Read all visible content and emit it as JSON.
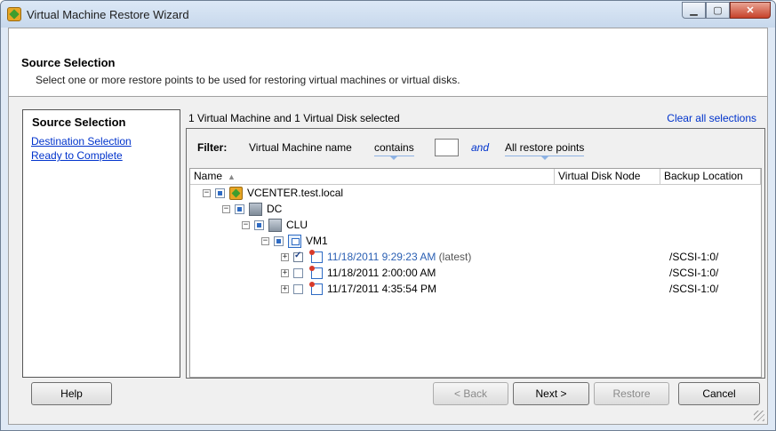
{
  "window": {
    "title": "Virtual Machine Restore Wizard"
  },
  "header": {
    "title": "Source Selection",
    "description": "Select one or more restore points to be used for restoring virtual machines or virtual disks."
  },
  "steps": [
    {
      "label": "Source Selection",
      "current": true
    },
    {
      "label": "Destination Selection",
      "current": false
    },
    {
      "label": "Ready to Complete",
      "current": false
    }
  ],
  "selection_summary": "1 Virtual Machine and 1 Virtual Disk selected",
  "clear_all_label": "Clear all selections",
  "filter": {
    "label": "Filter:",
    "field": "Virtual Machine name",
    "operator": "contains",
    "value": "",
    "conjunction": "and",
    "scope": "All restore points"
  },
  "grid": {
    "columns": [
      "Name",
      "Virtual Disk Node",
      "Backup Location"
    ],
    "rows": [
      {
        "name": "VCENTER.test.local",
        "icon": "vcenter-icon",
        "expander": "minus"
      },
      {
        "name": "DC",
        "icon": "datacenter-icon",
        "expander": "minus"
      },
      {
        "name": "CLU",
        "icon": "cluster-icon",
        "expander": "minus"
      },
      {
        "name": "VM1",
        "icon": "vm-icon",
        "expander": "minus"
      },
      {
        "name": "11/18/2011 9:29:23 AM",
        "tag": "(latest)",
        "icon": "restore-point-icon",
        "expander": "plus",
        "checked": true,
        "location": "/SCSI-1:0/"
      },
      {
        "name": "11/18/2011 2:00:00 AM",
        "icon": "restore-point-icon",
        "expander": "plus",
        "checked": false,
        "location": "/SCSI-1:0/"
      },
      {
        "name": "11/17/2011 4:35:54 PM",
        "icon": "restore-point-icon",
        "expander": "plus",
        "checked": false,
        "location": "/SCSI-1:0/"
      }
    ]
  },
  "buttons": {
    "help": "Help",
    "back": "< Back",
    "next": "Next >",
    "restore": "Restore",
    "cancel": "Cancel"
  },
  "colors": {
    "link": "#0033cc",
    "selected_text": "#2a5fb3"
  }
}
